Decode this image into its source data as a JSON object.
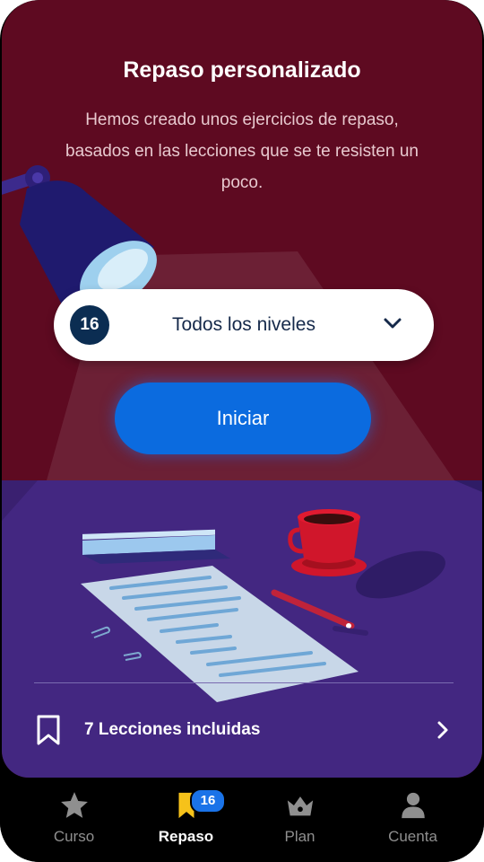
{
  "review": {
    "title": "Repaso personalizado",
    "description": "Hemos creado unos ejercicios de repaso, basados en las lecciones que se te resisten un poco."
  },
  "level_selector": {
    "count": "16",
    "label": "Todos los niveles",
    "icon": "chevron-down-icon"
  },
  "start_button": {
    "label": "Iniciar"
  },
  "lessons": {
    "label": "7 Lecciones incluidas",
    "icon": "bookmark-icon"
  },
  "tabbar": {
    "items": [
      {
        "label": "Curso",
        "icon": "star-icon",
        "active": false
      },
      {
        "label": "Repaso",
        "icon": "bookmark-icon",
        "active": true,
        "badge": "16"
      },
      {
        "label": "Plan",
        "icon": "crown-icon",
        "active": false
      },
      {
        "label": "Cuenta",
        "icon": "person-icon",
        "active": false
      }
    ]
  },
  "colors": {
    "background": "#5e0a21",
    "desk": "#432781",
    "primary": "#0b6bdf",
    "badge": "#0b2d52"
  }
}
